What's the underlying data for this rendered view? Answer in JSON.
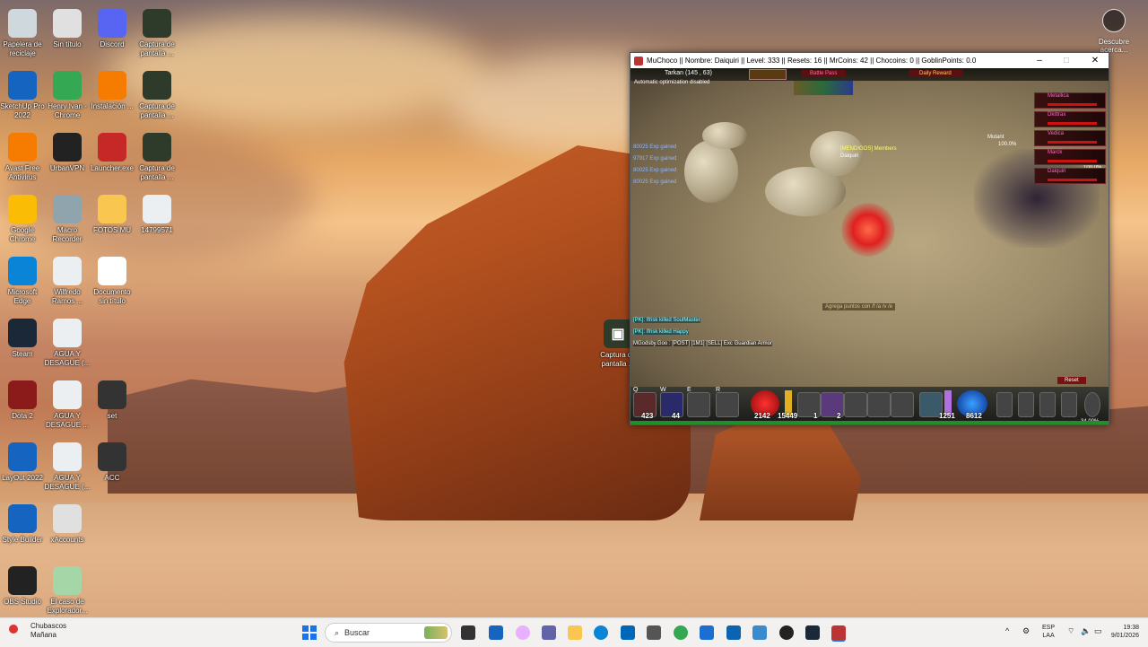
{
  "desktop": {
    "icons": [
      {
        "label": "Papelera de\nreciclaje",
        "icon": "recycle-bin-icon",
        "color": "#cfd8dc"
      },
      {
        "label": "Sin título",
        "icon": "text-file-icon",
        "color": "#e0e0e0"
      },
      {
        "label": "Discord",
        "icon": "discord-icon",
        "color": "#5865F2"
      },
      {
        "label": "Captura de\npantalla ...",
        "icon": "screenshot-icon",
        "color": "#2e3b2a"
      },
      {
        "label": "SketchUp Pro\n2022",
        "icon": "sketchup-icon",
        "color": "#1565c0"
      },
      {
        "label": "Henry Ivan -\nChrome",
        "icon": "chrome-icon",
        "color": "#34a853"
      },
      {
        "label": "Instalación ...",
        "icon": "avast-install-icon",
        "color": "#f57c00"
      },
      {
        "label": "Captura de\npantalla ...",
        "icon": "screenshot-icon",
        "color": "#2e3b2a"
      },
      {
        "label": "Avast Free\nAntivirus",
        "icon": "avast-icon",
        "color": "#f57c00"
      },
      {
        "label": "UrbanVPN",
        "icon": "urbanvpn-icon",
        "color": "#222"
      },
      {
        "label": "Launcher.exe",
        "icon": "launcher-icon",
        "color": "#c62828"
      },
      {
        "label": "Captura de\npantalla ...",
        "icon": "screenshot-icon",
        "color": "#2e3b2a"
      },
      {
        "label": "Google\nChrome",
        "icon": "chrome-icon",
        "color": "#fbbc05"
      },
      {
        "label": "Macro\nRecorder",
        "icon": "macro-recorder-icon",
        "color": "#90a4ae"
      },
      {
        "label": "FOTOS MU",
        "icon": "folder-icon",
        "color": "#f9c74f"
      },
      {
        "label": "14799571",
        "icon": "document-icon",
        "color": "#eceff1"
      },
      {
        "label": "Microsoft\nEdge",
        "icon": "edge-icon",
        "color": "#0a84d6"
      },
      {
        "label": "Wilfredo\nRamos ...",
        "icon": "document-icon",
        "color": "#eceff1"
      },
      {
        "label": "Documento\nsin título",
        "icon": "document-icon",
        "color": "#ffffff"
      },
      {
        "label": "Steam",
        "icon": "steam-icon",
        "color": "#1b2838"
      },
      {
        "label": "AGUA Y\nDESAGUE (...",
        "icon": "document-icon",
        "color": "#eceff1"
      },
      {
        "label": "Dota 2",
        "icon": "dota-icon",
        "color": "#8b1a1a"
      },
      {
        "label": "AGUA Y\nDESAGUE ...",
        "icon": "document-icon",
        "color": "#eceff1"
      },
      {
        "label": "set",
        "icon": "game-shortcut-icon",
        "color": "#333"
      },
      {
        "label": "LayOut 2022",
        "icon": "layout-icon",
        "color": "#1565c0"
      },
      {
        "label": "AGUA Y\nDESAGUE (...",
        "icon": "document-icon",
        "color": "#eceff1"
      },
      {
        "label": "ACC",
        "icon": "game-shortcut-icon",
        "color": "#333"
      },
      {
        "label": "Style Builder",
        "icon": "style-builder-icon",
        "color": "#1565c0"
      },
      {
        "label": "xAccounts",
        "icon": "xaccounts-icon",
        "color": "#e0e0e0"
      },
      {
        "label": "OBS Studio",
        "icon": "obs-icon",
        "color": "#222"
      },
      {
        "label": "El caso de\nExplorador...",
        "icon": "document-icon",
        "color": "#a5d6a7"
      },
      {
        "label": "Captura de\npantalla ...",
        "icon": "screenshot-icon",
        "color": "#2e3b2a"
      }
    ],
    "discover": {
      "label": "Descubre\nacerca..."
    }
  },
  "game_window": {
    "title": "MuChoco || Nombre: Daiquiri || Level: 333 || Resets: 16 || MrCoins: 42 || Chocoins: 0 || GoblinPoints: 0.0",
    "location": "Tarkan (145 , 63)",
    "auto_opt": "Automatic optimization disabled",
    "battle_pass": "Battle Pass",
    "daily_reward": "Daily Reward",
    "exp_lines": [
      "80025 Exp gained",
      "97917 Exp gained",
      "80025 Exp gained",
      "80025 Exp gained"
    ],
    "guild_tag": "[MENDIGOS] Members",
    "player_name": "Daiquiri",
    "party": [
      "Metallica",
      "Dkittrax",
      "Vedica",
      "Marck",
      "Daiquiri"
    ],
    "mutant_label": "Mutant",
    "mutant_hp": "100.0%",
    "mutant_hp2": "100.0%",
    "center_msg": "Agrega puntos con /f /a /v /e",
    "chat": [
      "[PK]: Ifrisk killed SoulMaster",
      "[PK]: Ifrisk killed Happy",
      "MGodsby.Goo : [POST] [1M1] [SELL] Exc Guardian Armor"
    ],
    "reset_btn": "Reset",
    "hotbar": {
      "hp_pots": "423",
      "mana_pots": "44",
      "hp": "2142",
      "hp_max": "15449",
      "slot1": "1",
      "slot2": "2",
      "mana": "1251",
      "sd": "8612",
      "exp_pct": "34.00%"
    },
    "hotbar_keys": [
      "Q",
      "W",
      "E",
      "R"
    ],
    "desk_capture": "Captura de\npantalla ..."
  },
  "taskbar": {
    "weather_title": "Chubascos",
    "weather_sub": "Mañana",
    "search_placeholder": "Buscar",
    "lang": "ESP",
    "lang2": "LAA",
    "time": "19:38",
    "date": "9/01/2026"
  },
  "colors": {
    "taskbar_bg": "#f2f1f0",
    "accent": "#1a73e8",
    "hp_red": "#cc1111",
    "exp_green": "#1e8f2a"
  }
}
